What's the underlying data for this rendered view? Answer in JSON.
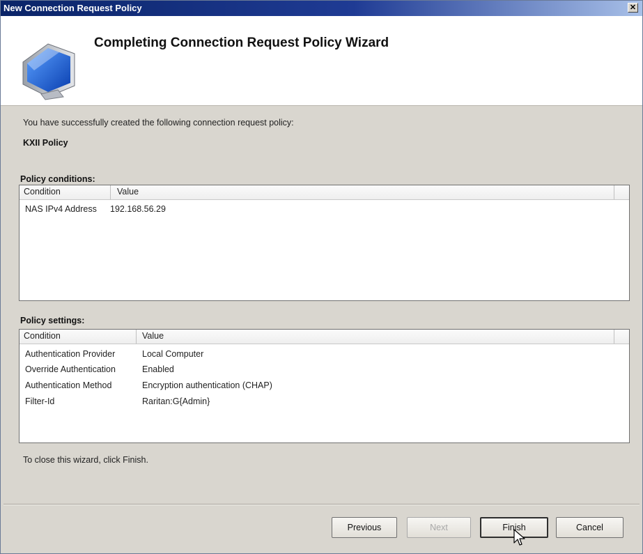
{
  "window": {
    "title": "New Connection Request Policy",
    "close_glyph": "✕"
  },
  "header": {
    "title": "Completing Connection Request Policy Wizard",
    "icon": "computer-monitor-icon"
  },
  "body": {
    "intro": "You have successfully created the following connection request policy:",
    "policy_name": "KXII Policy",
    "conditions": {
      "label": "Policy conditions:",
      "columns": [
        "Condition",
        "Value"
      ],
      "rows": [
        [
          "NAS IPv4 Address",
          "192.168.56.29"
        ]
      ]
    },
    "settings": {
      "label": "Policy settings:",
      "columns": [
        "Condition",
        "Value"
      ],
      "rows": [
        [
          "Authentication Provider",
          "Local Computer"
        ],
        [
          "Override Authentication",
          "Enabled"
        ],
        [
          "Authentication Method",
          "Encryption authentication (CHAP)"
        ],
        [
          "Filter-Id",
          "Raritan:G{Admin}"
        ]
      ]
    },
    "close_hint": "To close this wizard, click Finish."
  },
  "buttons": {
    "previous": "Previous",
    "next": "Next",
    "finish": "Finish",
    "cancel": "Cancel"
  },
  "colors": {
    "titlebar": "#0a2468",
    "dialog_bg": "#d9d6cf"
  }
}
